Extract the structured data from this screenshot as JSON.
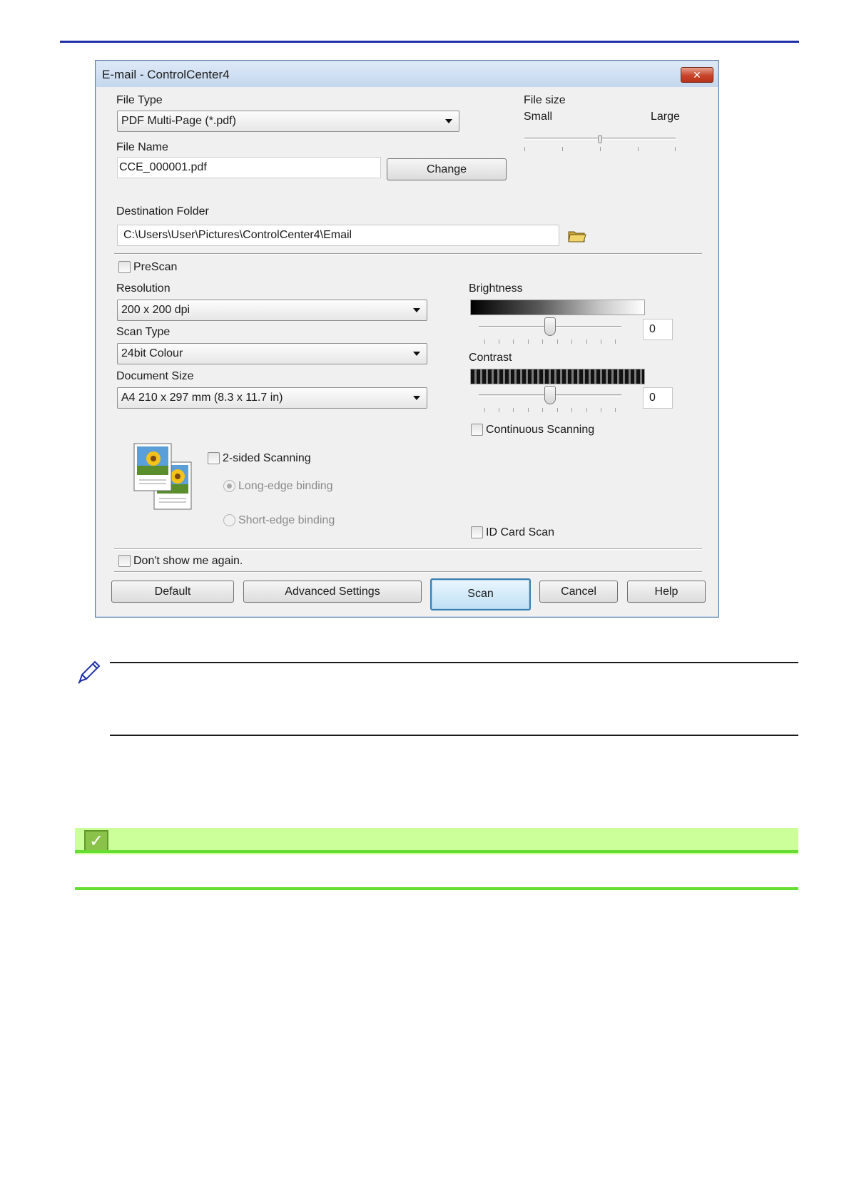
{
  "dialog": {
    "title": "E-mail - ControlCenter4",
    "close_glyph": "✕",
    "file_type": {
      "label": "File Type",
      "value": "PDF Multi-Page (*.pdf)"
    },
    "file_size": {
      "label": "File size",
      "min_label": "Small",
      "max_label": "Large",
      "level": 0.5
    },
    "file_name": {
      "label": "File Name",
      "value": "CCE_000001.pdf",
      "change_button": "Change"
    },
    "destination": {
      "label": "Destination Folder",
      "value": "C:\\Users\\User\\Pictures\\ControlCenter4\\Email",
      "folder_icon": "folder-icon"
    },
    "prescan": {
      "label": "PreScan",
      "checked": false
    },
    "resolution": {
      "label": "Resolution",
      "value": "200 x 200 dpi"
    },
    "scan_type": {
      "label": "Scan Type",
      "value": "24bit Colour"
    },
    "document_size": {
      "label": "Document Size",
      "value": "A4 210 x 297 mm (8.3 x 11.7 in)"
    },
    "brightness": {
      "label": "Brightness",
      "value": "0"
    },
    "contrast": {
      "label": "Contrast",
      "value": "0"
    },
    "continuous_scanning": {
      "label": "Continuous Scanning",
      "checked": false
    },
    "two_sided": {
      "label": "2-sided Scanning",
      "checked": false,
      "long_edge": "Long-edge binding",
      "short_edge": "Short-edge binding",
      "illustration_icon": "two-sided-pages-icon"
    },
    "id_card": {
      "label": "ID Card Scan",
      "checked": false
    },
    "dont_show": {
      "label": "Don't show me again.",
      "checked": false
    },
    "buttons": {
      "default": "Default",
      "advanced": "Advanced Settings",
      "scan": "Scan",
      "cancel": "Cancel",
      "help": "Help"
    }
  },
  "note": {
    "icon": "pencil-icon"
  },
  "related": {
    "icon": "checkmark-icon",
    "glyph": "✓"
  },
  "colors": {
    "rule": "#1e2fa8",
    "related_bar": "#ccff99",
    "related_line": "#66dd33"
  }
}
